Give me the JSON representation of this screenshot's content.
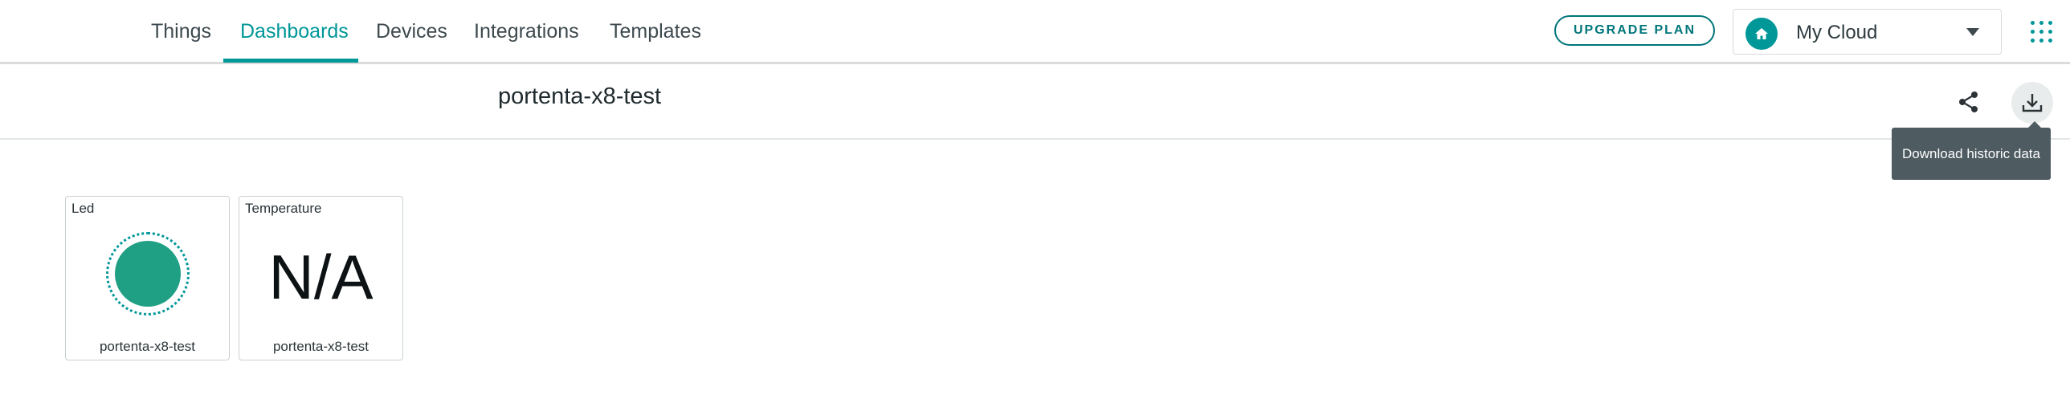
{
  "nav": {
    "tabs": [
      {
        "label": "Things"
      },
      {
        "label": "Dashboards"
      },
      {
        "label": "Devices"
      },
      {
        "label": "Integrations"
      },
      {
        "label": "Templates"
      }
    ],
    "active_tab": "Dashboards",
    "upgrade_label": "UPGRADE PLAN",
    "cloud_selector": {
      "label": "My Cloud",
      "icon": "home-icon"
    },
    "apps_icon": "apps-grid-icon"
  },
  "dashboard": {
    "title": "portenta-x8-test",
    "share_icon": "share-icon",
    "download_icon": "download-icon",
    "tooltip": "Download historic data"
  },
  "widgets": [
    {
      "title": "Led",
      "type": "led",
      "state": "on",
      "footer": "portenta-x8-test"
    },
    {
      "title": "Temperature",
      "type": "value",
      "value": "N/A",
      "footer": "portenta-x8-test"
    }
  ],
  "colors": {
    "accent": "#009799",
    "led_on": "#1fa084",
    "tooltip_bg": "#4e5b61"
  }
}
